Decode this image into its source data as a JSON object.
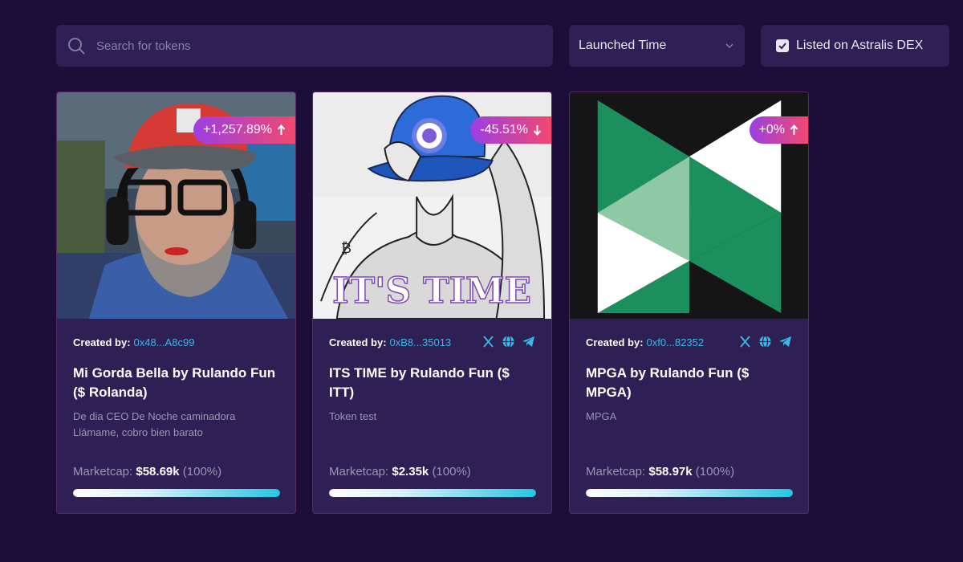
{
  "search": {
    "placeholder": "Search for tokens",
    "icon": "search-icon"
  },
  "sort": {
    "label": "Launched Time",
    "icon": "chevron-down-icon"
  },
  "listed_filter": {
    "label": "Listed on Astralis DEX",
    "checked": true
  },
  "colors": {
    "background": "#1b0f3a",
    "panel": "#2e1f55",
    "accent_link": "#3ab8e6",
    "badge_gradient": [
      "#9b3fe4",
      "#f2486e"
    ],
    "progress_gradient": [
      "#ffffff",
      "#27c6e0"
    ]
  },
  "cards": [
    {
      "change": "+1,257.89%",
      "direction": "up",
      "created_by_label": "Created by:",
      "creator_address": "0x48...A8c99",
      "has_socials": false,
      "title": "Mi Gorda Bella by Rulando Fun ($ Rolanda)",
      "description": "De dia CEO De Noche caminadora Llámame, cobro bien barato",
      "marketcap_label": "Marketcap:",
      "marketcap_value": "$58.69k",
      "marketcap_pct": "(100%)",
      "progress": 1.0
    },
    {
      "change": "-45.51%",
      "direction": "down",
      "created_by_label": "Created by:",
      "creator_address": "0xB8...35013",
      "has_socials": true,
      "image_text": "IT'S TIME",
      "title": "ITS TIME by Rulando Fun ($ ITT)",
      "description": "Token test",
      "marketcap_label": "Marketcap:",
      "marketcap_value": "$2.35k",
      "marketcap_pct": "(100%)",
      "progress": 1.0
    },
    {
      "change": "+0%",
      "direction": "up",
      "created_by_label": "Created by:",
      "creator_address": "0xf0...82352",
      "has_socials": true,
      "title": "MPGA by Rulando Fun ($ MPGA)",
      "description": "MPGA",
      "marketcap_label": "Marketcap:",
      "marketcap_value": "$58.97k",
      "marketcap_pct": "(100%)",
      "progress": 1.0
    }
  ],
  "social_icons": [
    "x-icon",
    "globe-icon",
    "telegram-icon"
  ]
}
